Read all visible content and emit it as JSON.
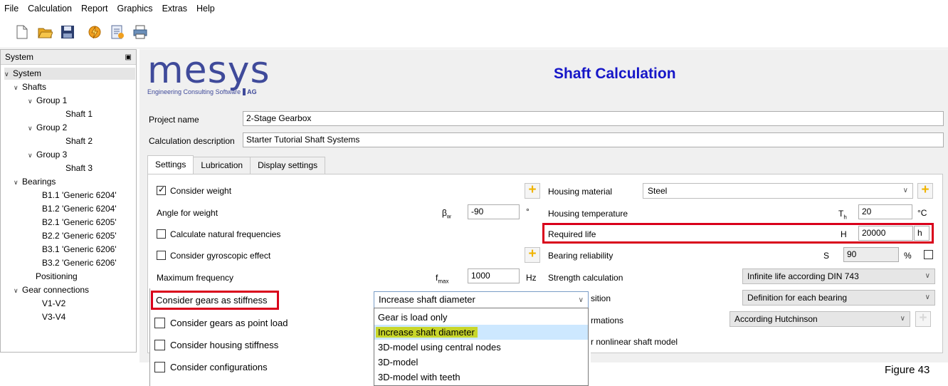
{
  "menu": [
    "File",
    "Calculation",
    "Report",
    "Graphics",
    "Extras",
    "Help"
  ],
  "toolbar": {
    "icons": [
      "new-file-icon",
      "open-folder-icon",
      "save-icon",
      "calculate-icon",
      "report-icon",
      "print-icon"
    ]
  },
  "tree": {
    "header": "System",
    "pin_icon": "pin-icon",
    "nodes": [
      {
        "label": "System",
        "expanded": true
      },
      {
        "label": "Shafts",
        "expanded": true
      },
      {
        "label": "Group 1",
        "expanded": true
      },
      {
        "label": "Shaft 1"
      },
      {
        "label": "Group 2",
        "expanded": true
      },
      {
        "label": "Shaft 2"
      },
      {
        "label": "Group 3",
        "expanded": true
      },
      {
        "label": "Shaft 3"
      },
      {
        "label": "Bearings",
        "expanded": true
      },
      {
        "label": "B1.1 'Generic 6204'"
      },
      {
        "label": "B1.2 'Generic 6204'"
      },
      {
        "label": "B2.1 'Generic 6205'"
      },
      {
        "label": "B2.2 'Generic 6205'"
      },
      {
        "label": "B3.1 'Generic 6206'"
      },
      {
        "label": "B3.2 'Generic 6206'"
      },
      {
        "label": "Positioning"
      },
      {
        "label": "Gear connections",
        "expanded": true
      },
      {
        "label": "V1-V2"
      },
      {
        "label": "V3-V4"
      }
    ]
  },
  "logo": {
    "word": "mesys",
    "tagline": "Engineering Consulting Software",
    "suffix": "AG"
  },
  "header": {
    "title": "Shaft Calculation"
  },
  "project": {
    "name_label": "Project name",
    "name_value": "2-Stage Gearbox",
    "desc_label": "Calculation description",
    "desc_value": "Starter Tutorial Shaft Systems"
  },
  "tabs": [
    "Settings",
    "Lubrication",
    "Display settings"
  ],
  "settings": {
    "consider_weight": "Consider weight",
    "angle_for_weight": "Angle for weight",
    "beta_symbol": "β",
    "beta_sub": "w",
    "angle_value": "-90",
    "angle_unit": "°",
    "calc_natural_freq": "Calculate natural frequencies",
    "gyroscopic": "Consider gyroscopic effect",
    "max_frequency": "Maximum frequency",
    "fmax_symbol": "f",
    "fmax_sub": "max",
    "fmax_value": "1000",
    "fmax_unit": "Hz",
    "gears_stiffness": "Consider gears as stiffness",
    "gears_point_load": "Consider gears as point load",
    "housing_stiffness": "Consider housing stiffness",
    "configurations": "Consider configurations",
    "housing_material": "Housing material",
    "housing_material_value": "Steel",
    "housing_temp": "Housing temperature",
    "th_symbol": "T",
    "th_sub": "h",
    "housing_temp_value": "20",
    "housing_temp_unit": "°C",
    "required_life": "Required life",
    "life_symbol": "H",
    "life_value": "20000",
    "life_unit": "h",
    "bearing_reliability": "Bearing reliability",
    "s_symbol": "S",
    "reliability_value": "90",
    "reliability_unit": "%",
    "strength_calc": "Strength calculation",
    "strength_value": "Infinite life according DIN 743",
    "position_partial": "sition",
    "position_value": "Definition for each bearing",
    "formations_partial": "rmations",
    "formations_value": "According Hutchinson",
    "nonlinear_partial": "r nonlinear shaft model"
  },
  "dropdown": {
    "selected": "Increase shaft diameter",
    "options": [
      "Gear is load only",
      "Increase shaft diameter",
      "3D-model using central nodes",
      "3D-model",
      "3D-model with teeth"
    ],
    "highlight_index": 1
  },
  "caption": "Figure 43",
  "colors": {
    "title": "#1616c8",
    "red_highlight": "#d9001b",
    "option_highlight": "#c8d62a",
    "logo": "#3f4a9a"
  }
}
